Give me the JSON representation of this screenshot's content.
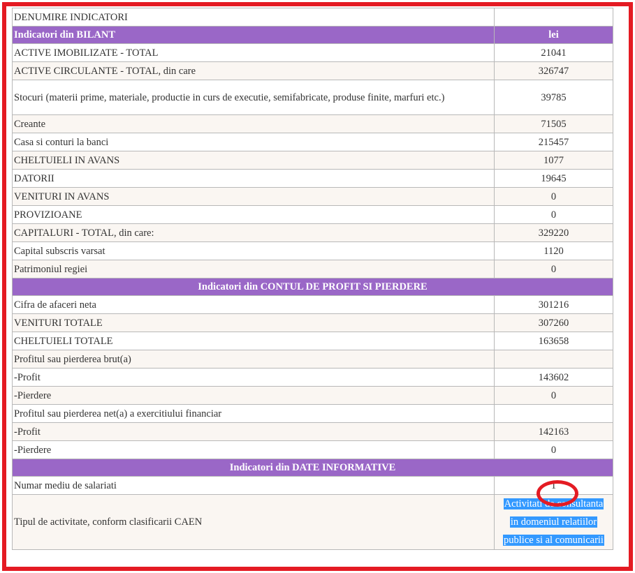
{
  "header": {
    "label": "DENUMIRE INDICATORI",
    "value": ""
  },
  "bilant": {
    "title": "Indicatori din BILANT",
    "unit": "lei",
    "rows": [
      {
        "label": "ACTIVE IMOBILIZATE - TOTAL",
        "value": "21041"
      },
      {
        "label": "ACTIVE CIRCULANTE - TOTAL, din care",
        "value": "326747"
      },
      {
        "label": "Stocuri (materii prime, materiale, productie in curs de executie, semifabricate, produse finite, marfuri etc.)",
        "value": "39785"
      },
      {
        "label": "Creante",
        "value": "71505"
      },
      {
        "label": "Casa si conturi la banci",
        "value": "215457"
      },
      {
        "label": "CHELTUIELI IN AVANS",
        "value": "1077"
      },
      {
        "label": "DATORII",
        "value": "19645"
      },
      {
        "label": "VENITURI IN AVANS",
        "value": "0"
      },
      {
        "label": "PROVIZIOANE",
        "value": "0"
      },
      {
        "label": "CAPITALURI - TOTAL, din care:",
        "value": "329220"
      },
      {
        "label": "Capital subscris varsat",
        "value": "1120"
      },
      {
        "label": "Patrimoniul regiei",
        "value": "0"
      }
    ]
  },
  "profit": {
    "title": "Indicatori din CONTUL DE PROFIT SI PIERDERE",
    "rows": [
      {
        "label": "Cifra de afaceri neta",
        "value": "301216"
      },
      {
        "label": "VENITURI TOTALE",
        "value": "307260"
      },
      {
        "label": "CHELTUIELI TOTALE",
        "value": "163658"
      },
      {
        "label": "Profitul sau pierderea brut(a)",
        "value": ""
      },
      {
        "label": "-Profit",
        "value": "143602"
      },
      {
        "label": "-Pierdere",
        "value": "0"
      },
      {
        "label": "Profitul sau pierderea net(a) a exercitiului financiar",
        "value": ""
      },
      {
        "label": "-Profit",
        "value": "142163"
      },
      {
        "label": "-Pierdere",
        "value": "0"
      }
    ]
  },
  "informative": {
    "title": "Indicatori din DATE INFORMATIVE",
    "employees": {
      "label": "Numar mediu de salariati",
      "value": "1"
    },
    "caen": {
      "label": "Tipul de activitate, conform clasificarii CAEN",
      "lines": [
        "Activitati de consultanta",
        "in domeniul relatiilor",
        "publice si al comunicarii"
      ]
    }
  },
  "colors": {
    "frame": "#e41b23",
    "section_header": "#9a67c7",
    "selection": "#3399ff"
  }
}
